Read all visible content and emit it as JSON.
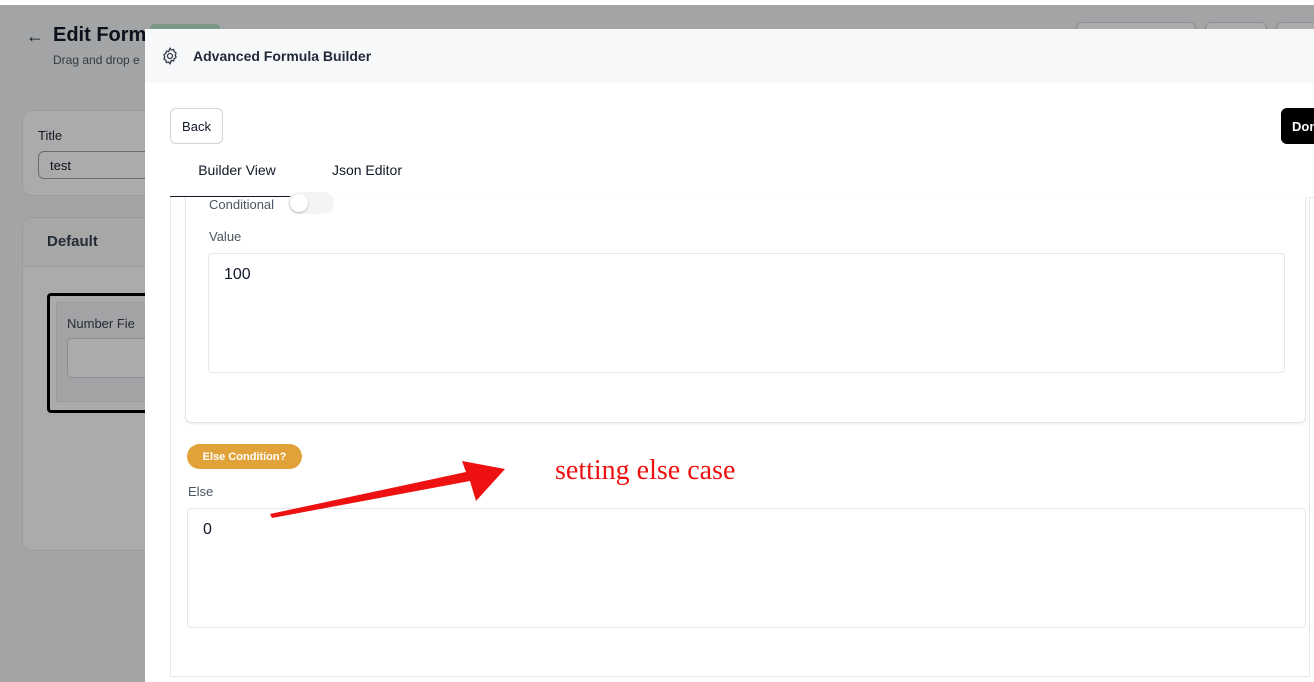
{
  "background_page": {
    "title": "Edit Form",
    "subtitle": "Drag and drop e",
    "title_card": {
      "label": "Title",
      "input_value": "test"
    },
    "default_section": {
      "label": "Default",
      "field_label": "Number Fie"
    }
  },
  "modal": {
    "title": "Advanced Formula Builder",
    "icon": "gear-icon",
    "back_label": "Back",
    "done_label": "Don",
    "tabs": [
      {
        "label": "Builder View",
        "active": true
      },
      {
        "label": "Json Editor",
        "active": false
      }
    ],
    "condition": {
      "conditional_label": "Conditional",
      "conditional_on": false,
      "value_label": "Value",
      "value": "100"
    },
    "else": {
      "badge_label": "Else Condition?",
      "label": "Else",
      "value": "0"
    }
  },
  "annotation": {
    "text": "setting else case",
    "color": "#ee1111"
  },
  "colors": {
    "accent_badge": "#e2a23a",
    "primary_button": "#000000"
  }
}
